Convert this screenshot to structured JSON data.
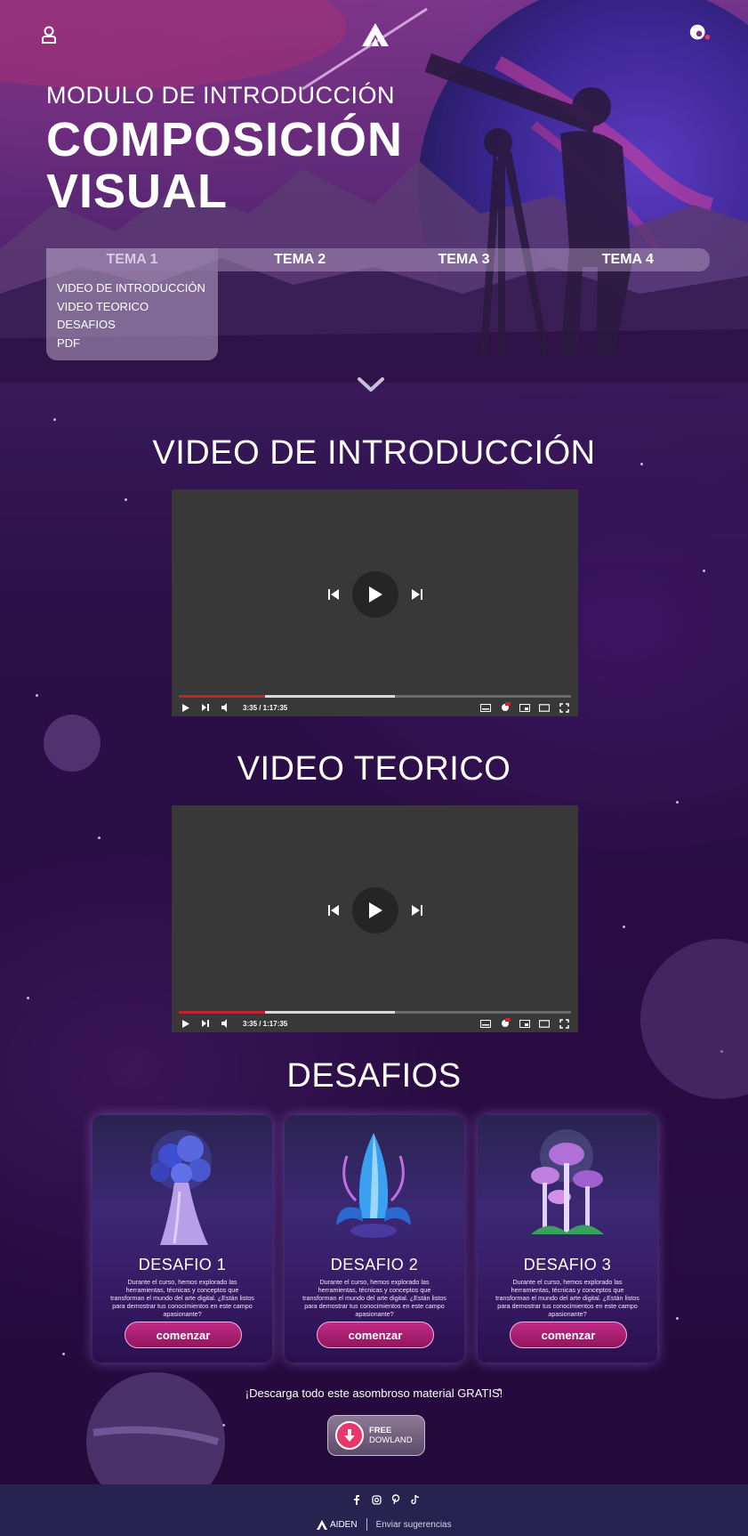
{
  "header": {
    "subtitle": "MODULO DE INTRODUCCIÓN",
    "title": "COMPOSICIÓN VISUAL"
  },
  "tabs": [
    {
      "label": "TEMA 1",
      "active": true
    },
    {
      "label": "TEMA 2",
      "active": false
    },
    {
      "label": "TEMA 3",
      "active": false
    },
    {
      "label": "TEMA 4",
      "active": false
    }
  ],
  "dropdown": {
    "items": [
      "VIDEO DE INTRODUCCIÓN",
      "VIDEO TEORICO",
      "DESAFIOS",
      "PDF"
    ]
  },
  "sections": {
    "intro_title": "VIDEO DE INTRODUCCIÓN",
    "theory_title": "VIDEO TEORICO",
    "challenges_title": "DESAFIOS"
  },
  "videos": [
    {
      "time": "3:35 / 1:17:35",
      "played_fraction": 0.22,
      "buffered_fraction": 0.55
    },
    {
      "time": "3:35 / 1:17:35",
      "played_fraction": 0.22,
      "buffered_fraction": 0.55
    }
  ],
  "challenges": [
    {
      "title": "DESAFIO 1",
      "text": "Durante el curso, hemos explorado las herramientas, técnicas y conceptos que transforman el mundo del arte digital. ¿Están listos para demostrar tus conocimientos en este campo apasionante?",
      "button": "comenzar",
      "icon": "blue-mushroom-tree-icon"
    },
    {
      "title": "DESAFIO 2",
      "text": "Durante el curso, hemos explorado las herramientas, técnicas y conceptos que transforman el mundo del arte digital. ¿Están listos para demostrar tus conocimientos en este campo apasionante?",
      "button": "comenzar",
      "icon": "crystal-flower-icon"
    },
    {
      "title": "DESAFIO 3",
      "text": "Durante el curso, hemos explorado las herramientas, técnicas y conceptos que transforman el mundo del arte digital. ¿Están listos para demostrar tus conocimientos en este campo apasionante?",
      "button": "comenzar",
      "icon": "glowing-mushrooms-icon"
    }
  ],
  "download": {
    "text": "¡Descarga todo este asombroso material GRATIS!",
    "button_line1": "FREE",
    "button_line2": "DOWLAND"
  },
  "footer": {
    "brand": "AIDEN",
    "link": "Enviar sugerencias",
    "socials": [
      "facebook-icon",
      "instagram-icon",
      "pinterest-icon",
      "tiktok-icon"
    ]
  },
  "colors": {
    "accent": "#c02a86",
    "background": "#2a0c43",
    "footer": "#27224f",
    "progress": "#c4222c"
  }
}
